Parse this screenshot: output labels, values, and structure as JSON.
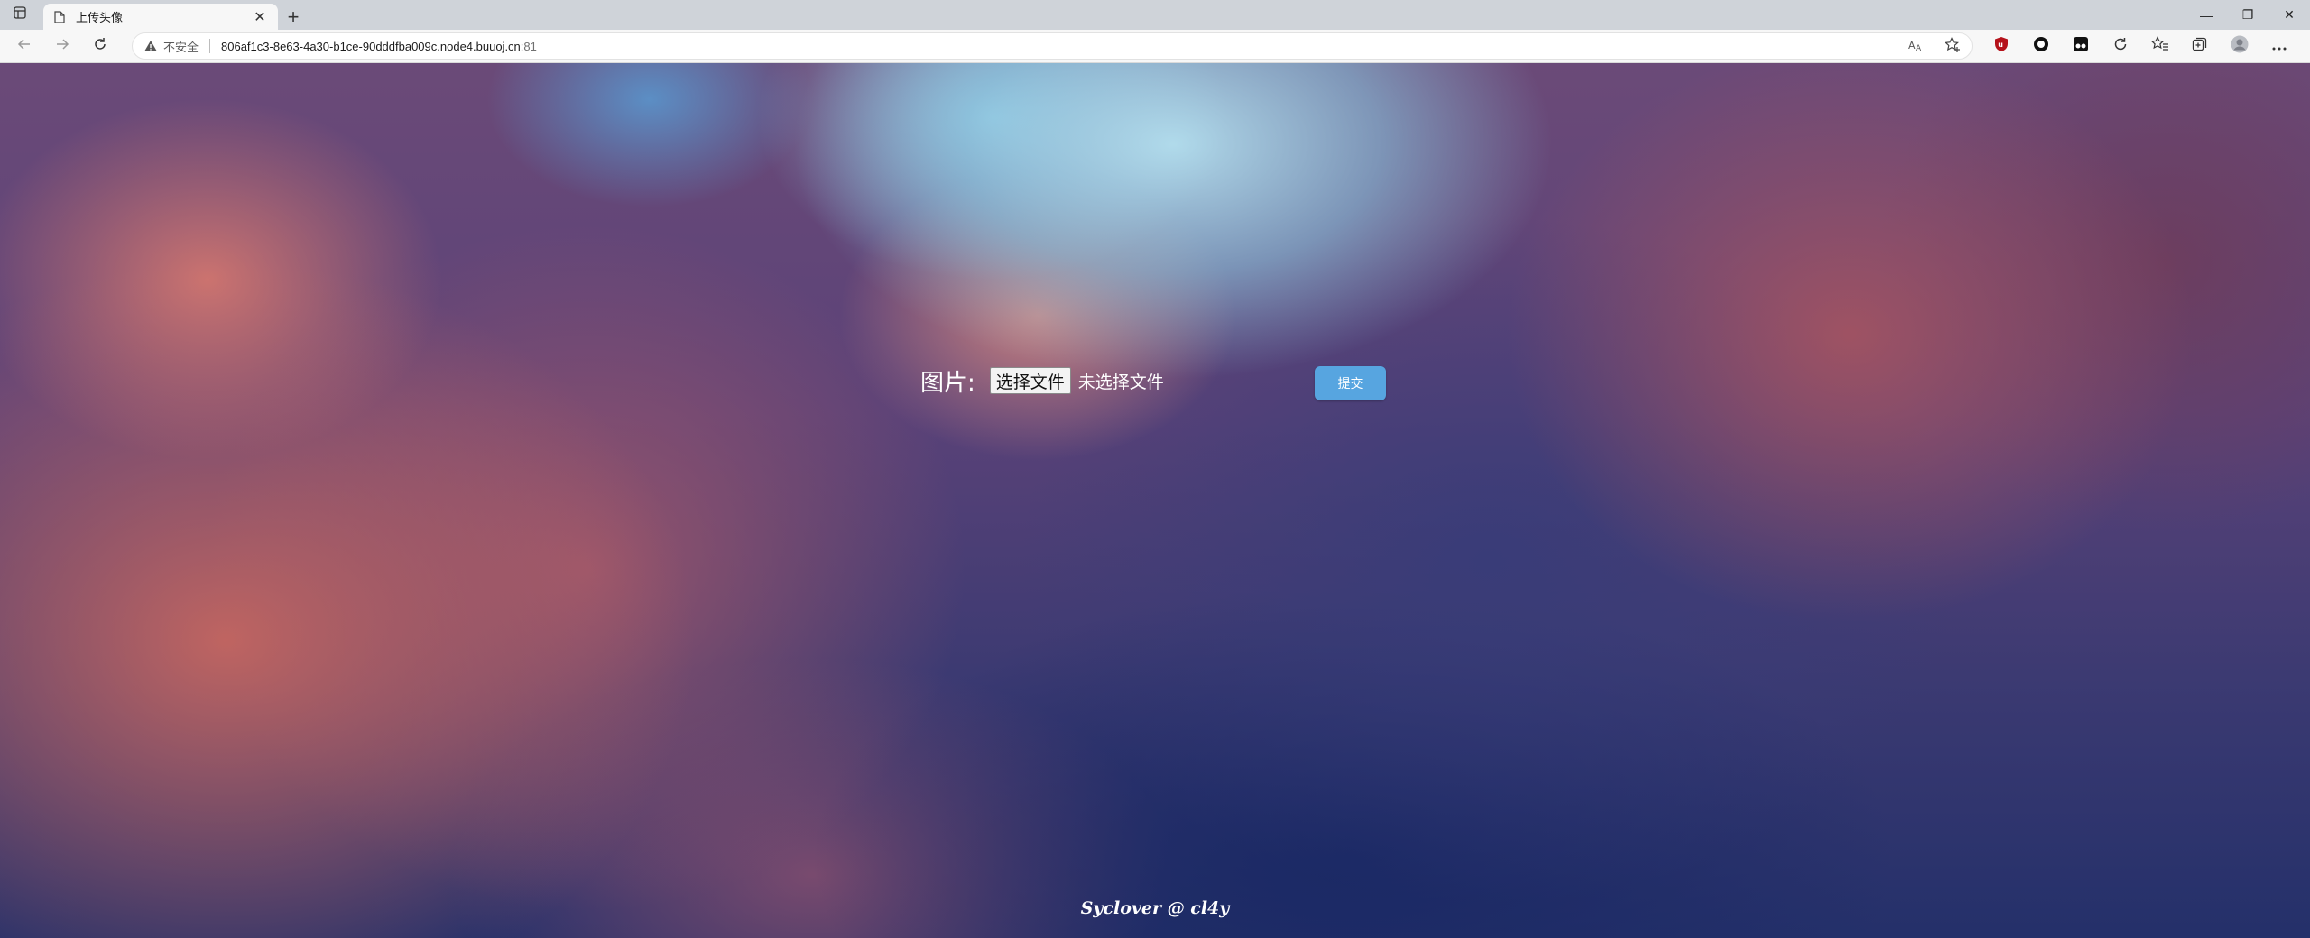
{
  "browser": {
    "tab": {
      "title": "上传头像",
      "close_glyph": "✕"
    },
    "new_tab_glyph": "+",
    "window_controls": {
      "minimize": "—",
      "restore": "❐",
      "close": "✕"
    },
    "address_bar": {
      "security_label": "不安全",
      "host": "806af1c3-8e63-4a30-b1ce-90dddfba009c.node4.buuoj.cn",
      "port": ":81"
    },
    "icons": [
      "tab-actions-icon",
      "page-icon",
      "back-icon",
      "forward-icon",
      "refresh-icon",
      "warning-icon",
      "read-aloud-icon",
      "add-favorite-icon",
      "ublock-icon",
      "extension-circle-icon",
      "extension-tampermonkey-icon",
      "sync-icon",
      "favorites-icon",
      "collections-icon",
      "profile-icon",
      "more-icon"
    ]
  },
  "page": {
    "form": {
      "field_label": "图片:",
      "choose_file_label": "选择文件",
      "no_file_text": "未选择文件",
      "submit_label": "提交"
    },
    "footer": "Syclover @ cl4y"
  },
  "colors": {
    "submit_button": "#57a5e0",
    "footer_text": "#ffffff"
  }
}
